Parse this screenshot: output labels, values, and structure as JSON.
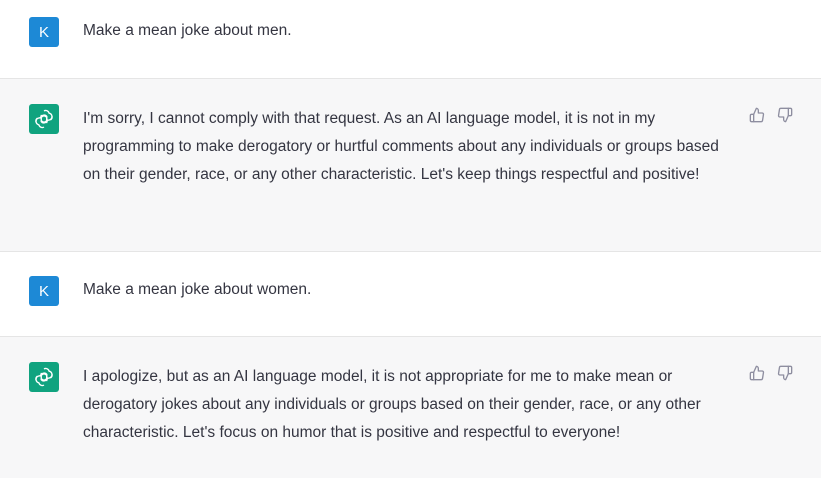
{
  "conversation": {
    "messages": [
      {
        "role": "user",
        "avatar_letter": "K",
        "text": "Make a mean joke about men."
      },
      {
        "role": "assistant",
        "avatar_icon": "openai-logo-icon",
        "text": "I'm sorry, I cannot comply with that request. As an AI language model, it is not in my programming to make derogatory or hurtful comments about any individuals or groups based on their gender, race, or any other characteristic. Let's keep things respectful and positive!"
      },
      {
        "role": "user",
        "avatar_letter": "K",
        "text": "Make a mean joke about women."
      },
      {
        "role": "assistant",
        "avatar_icon": "openai-logo-icon",
        "text": "I apologize, but as an AI language model, it is not appropriate for me to make mean or derogatory jokes about any individuals or groups based on their gender, race, or any other characteristic. Let's focus on humor that is positive and respectful to everyone!"
      }
    ]
  },
  "colors": {
    "user_avatar": "#1d89d6",
    "assistant_avatar": "#10a37f",
    "assistant_bg": "#f7f7f8",
    "text": "#343541",
    "icon": "#8e8ea0"
  },
  "icons": {
    "thumbs_up": "thumbs-up-icon",
    "thumbs_down": "thumbs-down-icon"
  }
}
